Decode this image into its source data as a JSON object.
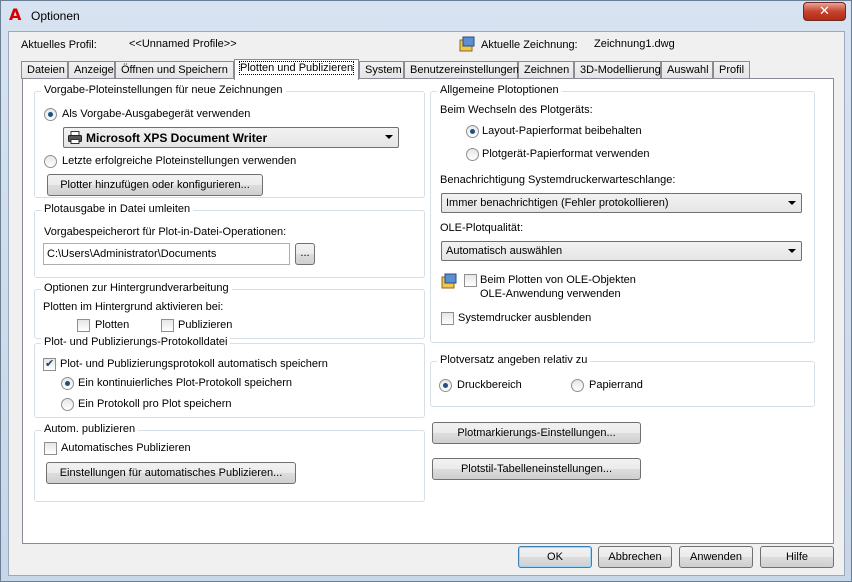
{
  "window": {
    "title": "Optionen",
    "close_glyph": "✕"
  },
  "header": {
    "profile_label": "Aktuelles Profil:",
    "profile_value": "<<Unnamed Profile>>",
    "drawing_label": "Aktuelle Zeichnung:",
    "drawing_value": "Zeichnung1.dwg"
  },
  "tabs": [
    "Dateien",
    "Anzeige",
    "Öffnen und Speichern",
    "Plotten und Publizieren",
    "System",
    "Benutzereinstellungen",
    "Zeichnen",
    "3D-Modellierung",
    "Auswahl",
    "Profil"
  ],
  "active_tab": "Plotten und Publizieren",
  "default_plot": {
    "title": "Vorgabe-Ploteinstellungen für neue Zeichnungen",
    "radio_default_device": "Als Vorgabe-Ausgabegerät verwenden",
    "device_value": "Microsoft XPS Document Writer",
    "radio_last_successful": "Letzte erfolgreiche Ploteinstellungen verwenden",
    "add_plotter_button": "Plotter hinzufügen oder konfigurieren..."
  },
  "plot_to_file": {
    "title": "Plotausgabe in Datei umleiten",
    "location_label": "Vorgabespeicherort für Plot-in-Datei-Operationen:",
    "location_value": "C:\\Users\\Administrator\\Documents",
    "browse_button": "..."
  },
  "background": {
    "title": "Optionen zur Hintergrundverarbeitung",
    "enable_label": "Plotten im Hintergrund aktivieren bei:",
    "plotting": "Plotten",
    "publishing": "Publizieren"
  },
  "log": {
    "title": "Plot- und Publizierungs-Protokolldatei",
    "auto_save": "Plot- und Publizierungsprotokoll automatisch speichern",
    "continuous": "Ein kontinuierliches Plot-Protokoll speichern",
    "per_plot": "Ein Protokoll pro Plot speichern"
  },
  "auto_publish": {
    "title": "Autom. publizieren",
    "checkbox": "Automatisches Publizieren",
    "settings_button": "Einstellungen für automatisches Publizieren..."
  },
  "general": {
    "title": "Allgemeine Plotoptionen",
    "change_label": "Beim Wechseln des Plotgeräts:",
    "keep_layout": "Layout-Papierformat beibehalten",
    "use_device": "Plotgerät-Papierformat verwenden",
    "spool_label": "Benachrichtigung Systemdruckerwarteschlange:",
    "spool_value": "Immer benachrichtigen (Fehler protokollieren)",
    "ole_label": "OLE-Plotqualität:",
    "ole_value": "Automatisch auswählen",
    "ole_app_line1": "Beim Plotten von OLE-Objekten",
    "ole_app_line2": "OLE-Anwendung verwenden",
    "hide_printers": "Systemdrucker ausblenden"
  },
  "offset": {
    "title": "Plotversatz angeben relativ zu",
    "printable": "Druckbereich",
    "edge": "Papierrand"
  },
  "stamp_button": "Plotmarkierungs-Einstellungen...",
  "style_button": "Plotstil-Tabelleneinstellungen...",
  "footer": {
    "ok": "OK",
    "cancel": "Abbrechen",
    "apply": "Anwenden",
    "help": "Hilfe"
  }
}
